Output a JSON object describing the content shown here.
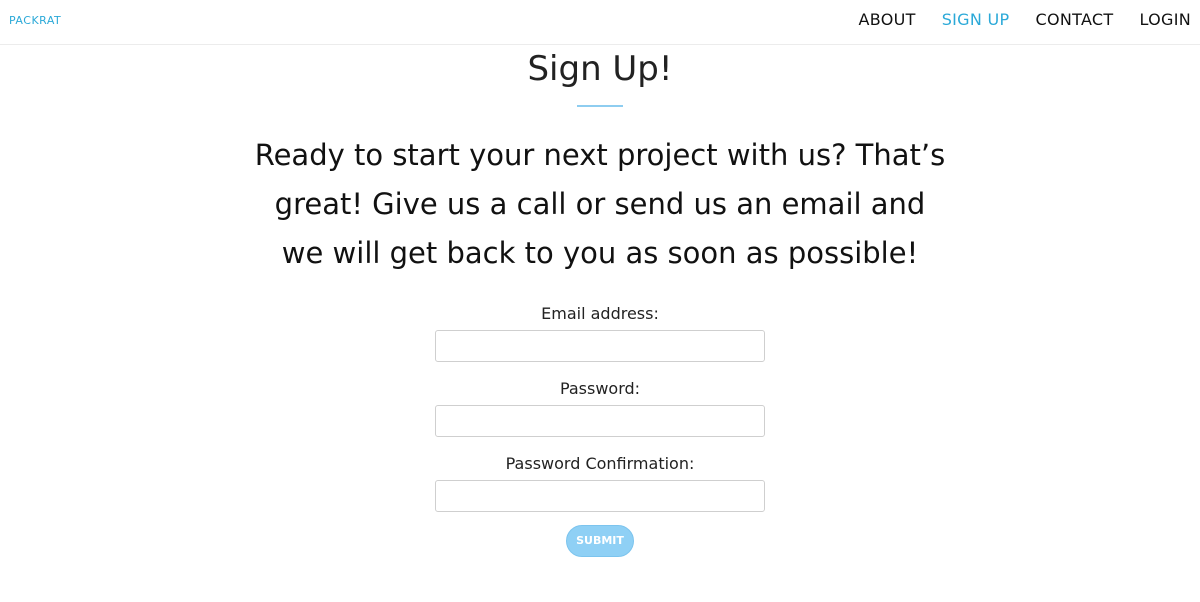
{
  "navbar": {
    "brand": "PACKRAT",
    "links": [
      {
        "label": "ABOUT",
        "active": false
      },
      {
        "label": "SIGN UP",
        "active": true
      },
      {
        "label": "CONTACT",
        "active": false
      },
      {
        "label": "LOGIN",
        "active": false
      }
    ],
    "accent_color": "#2ba9d8"
  },
  "main": {
    "title": "Sign Up!",
    "intro": "Ready to start your next project with us? That’s great! Give us a call or send us an email and we will get back to you as soon as possible!",
    "form": {
      "email_label": "Email address:",
      "email_value": "",
      "password_label": "Password:",
      "password_value": "",
      "password_confirmation_label": "Password Confirmation:",
      "password_confirmation_value": "",
      "submit_label": "SUBMIT",
      "submit_color": "#8fd0f5"
    }
  }
}
